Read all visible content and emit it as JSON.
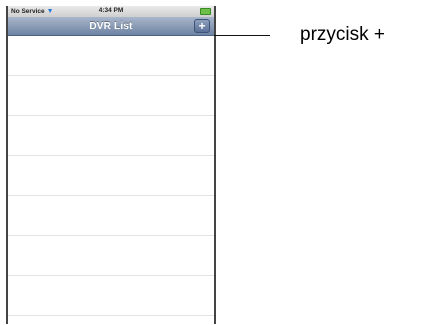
{
  "status_bar": {
    "carrier": "No Service",
    "wifi_icon": "wifi-icon",
    "time": "4:34 PM",
    "battery_icon": "battery-icon"
  },
  "nav_bar": {
    "title": "DVR List",
    "add_button_label": "+"
  },
  "list": {
    "rows": [
      "",
      "",
      "",
      "",
      "",
      "",
      ""
    ]
  },
  "annotation": {
    "label": "przycisk +"
  }
}
